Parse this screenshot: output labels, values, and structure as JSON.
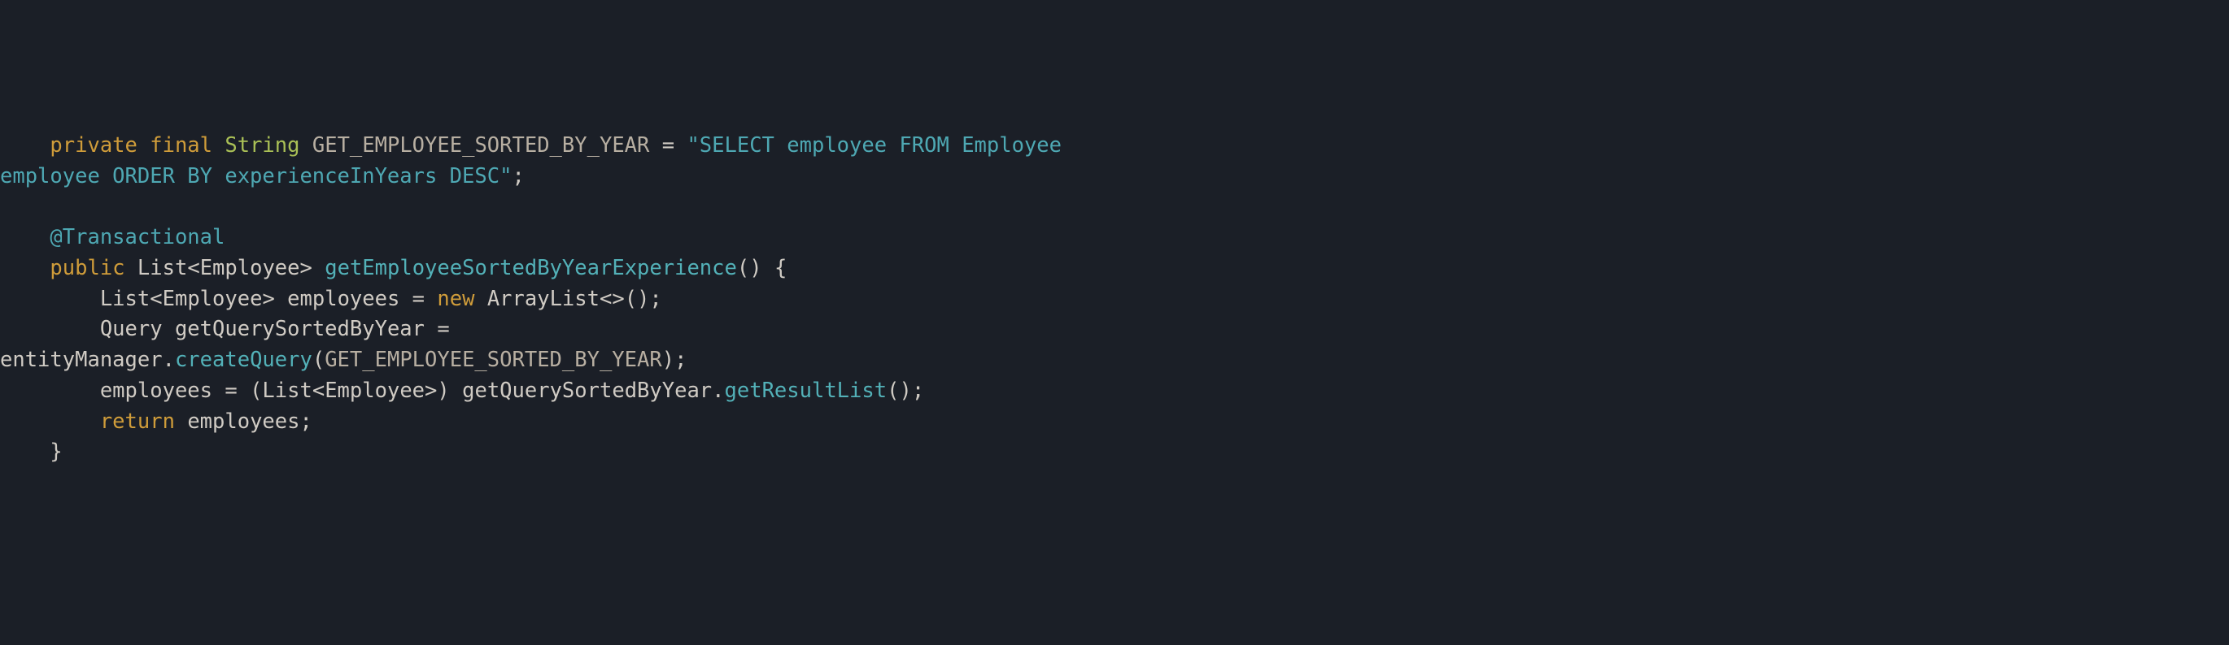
{
  "code": {
    "kw_private": "private",
    "kw_final": "final",
    "type_string": "String",
    "const_name": "GET_EMPLOYEE_SORTED_BY_YEAR",
    "eq": " = ",
    "str_open": "\"",
    "str_select": "SELECT employee FROM Employee ",
    "str_line2": "employee ORDER BY experienceInYears DESC",
    "str_close": "\"",
    "semi": ";",
    "annotation": "@Transactional",
    "kw_public": "public",
    "type_list": "List",
    "lt": "<",
    "type_employee": "Employee",
    "gt": ">",
    "method_name": "getEmployeeSortedByYearExperience",
    "paren_open": "(",
    "paren_close": ")",
    "brace_open": " {",
    "var_employees": "employees",
    "kw_new": "new",
    "type_arraylist": "ArrayList",
    "diamond": "<>",
    "type_query": "Query",
    "var_getQuery": "getQuerySortedByYear",
    "var_entityManager": "entityManager",
    "dot": ".",
    "method_createQuery": "createQuery",
    "method_getResultList": "getResultList",
    "kw_return": "return",
    "brace_close": "}",
    "indent1": "    ",
    "indent2": "        ",
    "sp": " ",
    "cast_open": "(",
    "cast_close": ")"
  }
}
